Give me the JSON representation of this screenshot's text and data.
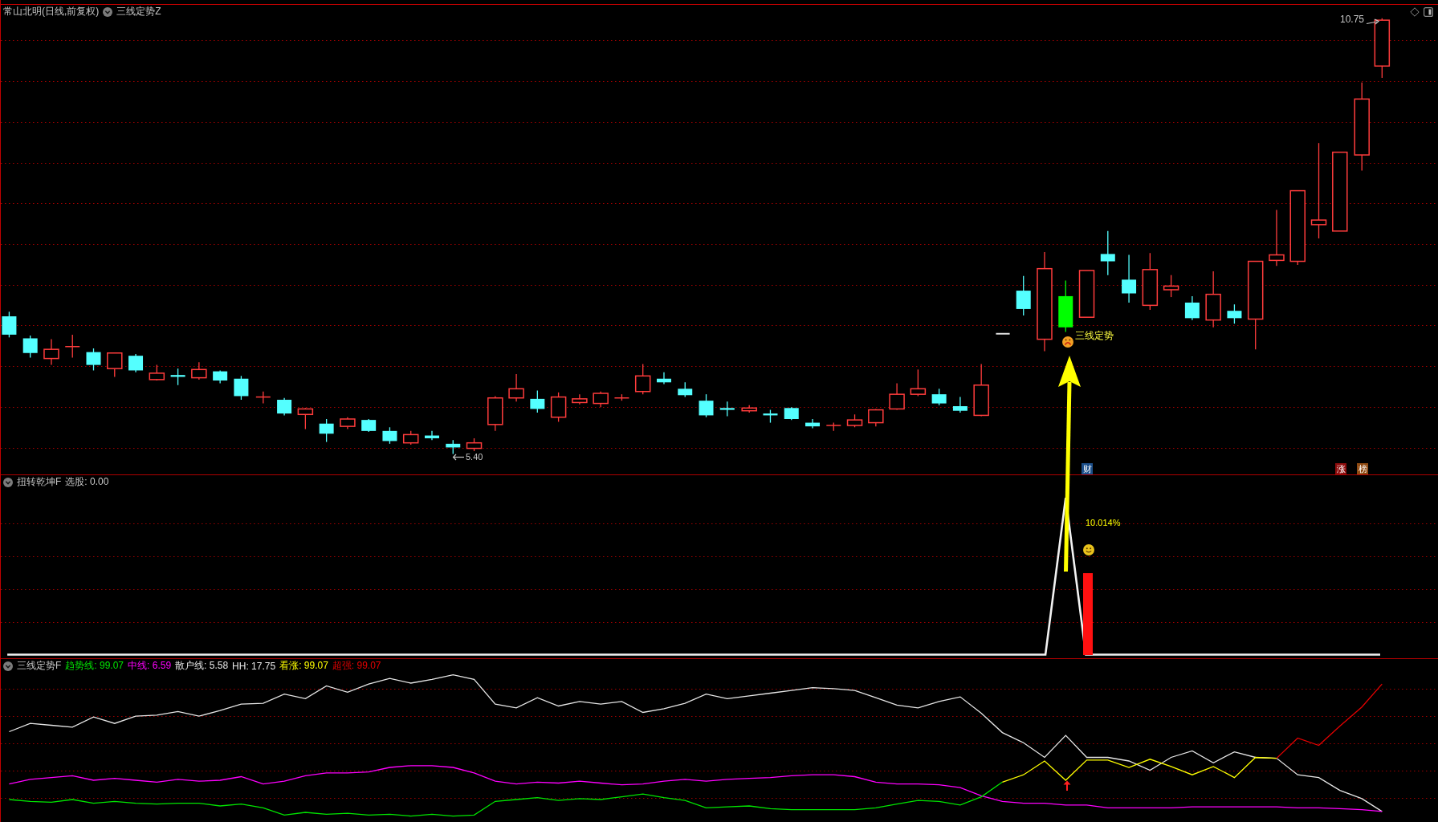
{
  "main_panel": {
    "title": "常山北明(日线,前复权)",
    "indicator": "三线定势Z",
    "high_label": "10.75",
    "low_label": "5.40",
    "signal_label": "三线定势",
    "badges": [
      {
        "text": "财",
        "color": "#1c4f8a"
      },
      {
        "text": "涨",
        "color": "#8c0c0c"
      },
      {
        "text": "榜",
        "color": "#8f4a12"
      }
    ]
  },
  "signal_panel": {
    "title": "扭转乾坤F",
    "reading": "选股: 0.00",
    "percent_label": "10.014%"
  },
  "trend_panel": {
    "title": "三线定势F",
    "legend": [
      {
        "label": "趋势线: 99.07",
        "color": "#00e600"
      },
      {
        "label": "中线: 6.59",
        "color": "#ff00ff"
      },
      {
        "label": "散户线: 5.58",
        "color": "#e6e6e6"
      },
      {
        "label": "HH: 17.75",
        "color": "#e6e6e6"
      },
      {
        "label": "看涨: 99.07",
        "color": "#ffff00"
      },
      {
        "label": "超强: 99.07",
        "color": "#e60000"
      }
    ]
  }
}
